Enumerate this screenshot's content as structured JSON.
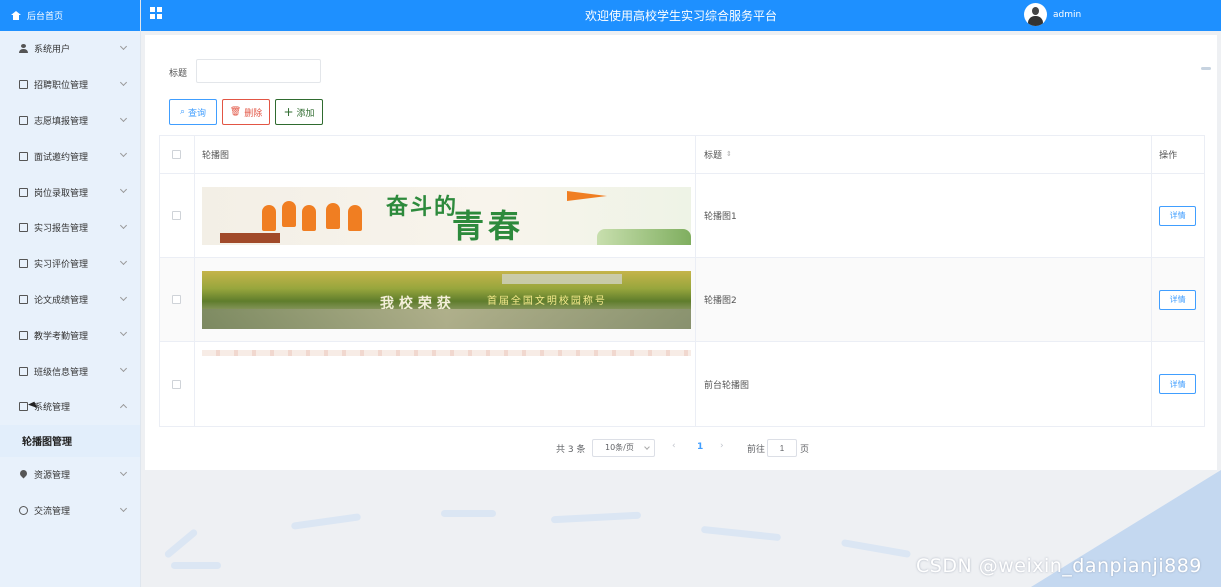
{
  "sidebar": {
    "home_label": "后台首页",
    "items": [
      {
        "label": "系统用户",
        "icon": "user-icon"
      },
      {
        "label": "招聘职位管理",
        "icon": "document-icon"
      },
      {
        "label": "志愿填报管理",
        "icon": "document-icon"
      },
      {
        "label": "面试邀约管理",
        "icon": "document-icon"
      },
      {
        "label": "岗位录取管理",
        "icon": "document-icon"
      },
      {
        "label": "实习报告管理",
        "icon": "document-icon"
      },
      {
        "label": "实习评价管理",
        "icon": "document-icon"
      },
      {
        "label": "论文成绩管理",
        "icon": "document-icon"
      },
      {
        "label": "教学考勤管理",
        "icon": "document-icon"
      },
      {
        "label": "班级信息管理",
        "icon": "document-icon"
      },
      {
        "label": "系统管理",
        "icon": "image-icon",
        "expanded": true
      },
      {
        "label": "资源管理",
        "icon": "pin-icon"
      },
      {
        "label": "交流管理",
        "icon": "chat-icon"
      }
    ],
    "sub_item": "轮播图管理"
  },
  "header": {
    "title": "欢迎使用高校学生实习综合服务平台",
    "user": "admin",
    "color": "#1e90ff"
  },
  "search": {
    "label": "标题",
    "value": "",
    "placeholder": ""
  },
  "toolbar": {
    "query_label": "查询",
    "delete_label": "删除",
    "add_label": "添加"
  },
  "table": {
    "columns": [
      "轮播图",
      "标题",
      "操作"
    ],
    "rows": [
      {
        "title": "轮播图1",
        "action": "详情",
        "image_text": [
          "奋斗的",
          "青春"
        ]
      },
      {
        "title": "轮播图2",
        "action": "详情",
        "image_text": [
          "我校荣获",
          "首届全国文明校园称号"
        ]
      },
      {
        "title": "前台轮播图",
        "action": "详情",
        "image_text": []
      }
    ]
  },
  "pager": {
    "total": "共 3 条",
    "page_size": "10条/页",
    "prev": "‹",
    "current": "1",
    "next": "›",
    "goto": "前往",
    "goto_value": "1",
    "unit": "页"
  },
  "watermark": "CSDN @weixin_danpianji889"
}
